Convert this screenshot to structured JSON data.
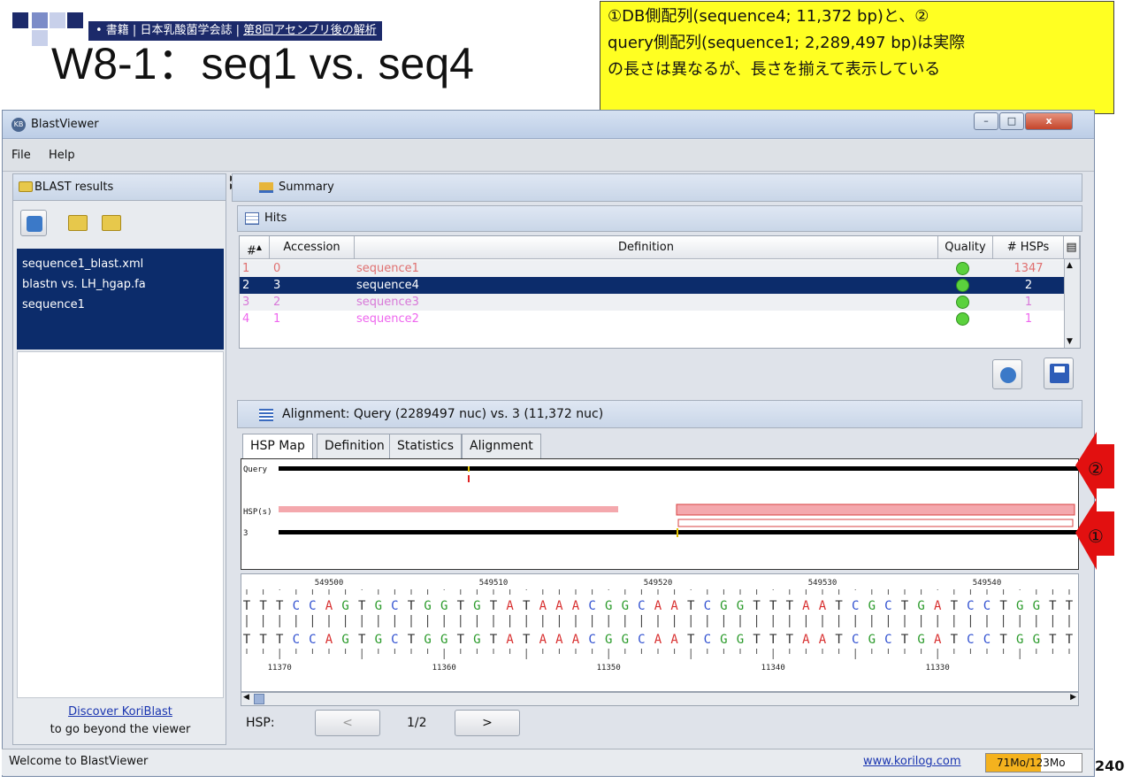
{
  "slide": {
    "breadcrumb_prefix": "• 書籍 | 日本乳酸菌学会誌 | ",
    "breadcrumb_link": "第8回アセンブリ後の解析",
    "title": "W8-1：seq1 vs. seq4",
    "note": "①DB側配列(sequence4; 11,372 bp)と、②\nquery側配列(sequence1; 2,289,497 bp)は実際\nの長さは異なるが、長さを揃えて表示している",
    "page_number": "240",
    "marker_1": "①",
    "marker_2": "②"
  },
  "window": {
    "title": "BlastViewer",
    "buttons": {
      "minimize": "–",
      "maximize": "□",
      "close": "x"
    }
  },
  "menu": {
    "file": "File",
    "help": "Help"
  },
  "left": {
    "header": "BLAST results",
    "items": [
      "sequence1_blast.xml",
      "blastn vs. LH_hgap.fa",
      "sequence1"
    ],
    "discover_link": "Discover KoriBlast",
    "discover_text": "to go beyond the viewer"
  },
  "summary": {
    "label": "Summary"
  },
  "hits": {
    "label": "Hits",
    "columns": [
      "#",
      "Accession",
      "Definition",
      "Quality",
      "# HSPs"
    ],
    "rows": [
      {
        "num": "1",
        "accession": "0",
        "definition": "sequence1",
        "hsps": "1347",
        "color": "#e07070"
      },
      {
        "num": "2",
        "accession": "3",
        "definition": "sequence4",
        "hsps": "2",
        "color": "#ffffff"
      },
      {
        "num": "3",
        "accession": "2",
        "definition": "sequence3",
        "hsps": "1",
        "color": "#d878d8"
      },
      {
        "num": "4",
        "accession": "1",
        "definition": "sequence2",
        "hsps": "1",
        "color": "#ee66ee"
      }
    ]
  },
  "alignment": {
    "header": "Alignment: Query (2289497 nuc) vs. 3 (11,372 nuc)",
    "tabs": [
      "HSP Map",
      "Definition",
      "Statistics",
      "Alignment"
    ],
    "map_labels": {
      "query": "Query",
      "hsps": "HSP(s)",
      "subject": "3"
    },
    "top_ticks": [
      "549500",
      "549510",
      "549520",
      "549530",
      "549540"
    ],
    "bottom_ticks": [
      "11370",
      "11360",
      "11350",
      "11340",
      "11330"
    ],
    "sequence": "TTTCCAGTGCTGGTGTATAAACGGCAATCGGTTTAATCGCTGATCCTGGTT"
  },
  "hsp_nav": {
    "label": "HSP:",
    "prev": "<",
    "page": "1/2",
    "next": ">"
  },
  "status": {
    "welcome": "Welcome to BlastViewer",
    "link": "www.korilog.com",
    "memory": "71Mo/123Mo",
    "memory_fraction": 0.577
  },
  "colors": {
    "A": "#d83030",
    "C": "#3050d0",
    "G": "#2a9a2a",
    "T": "#303030",
    "selection": "#0c2c6b",
    "hsp_pink": "#f4a8ad"
  }
}
